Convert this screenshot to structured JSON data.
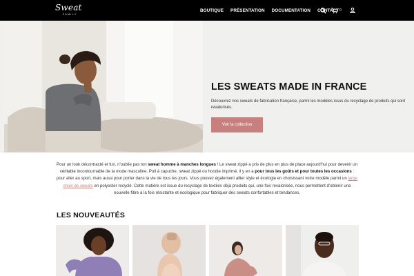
{
  "brand": {
    "name": "Sweat",
    "sub": "FAMILY"
  },
  "nav": {
    "items": [
      "BOUTIQUE",
      "PRÉSENTATION",
      "DOCUMENTATION",
      "CONTACT"
    ],
    "cart_count": "0"
  },
  "icons": [
    "search-icon",
    "cart-icon",
    "user-icon"
  ],
  "hero": {
    "title": "LES SWEATS MADE IN FRANCE",
    "text": "Découvrez nos sweats de fabrication française, parmi les modèles issus du recyclage de produits qui sont revalorisés.",
    "button": "Voir la collection"
  },
  "intro": {
    "p1": "Pour un look décontracté et fun, n'oublie pas ton ",
    "b1": "sweat homme à manches longues",
    "p2": " ! Le sweat zippé a pris de plus en plus de place aujourd'hui pour devenir un véritable incontournable de la mode masculine. Pull à capuche, sweat zippé ou hoodie imprimé, il y en a ",
    "b2": "pour tous les goûts et pour toutes les occasions",
    "p3": " : pour aller au sport, mais aussi pour porter dans la vie de tous les jours. Vous pouvez également allier style et écologie en choisissant votre modèle parmi un ",
    "link": "large choix de sweats",
    "p4": " en polyester recyclé. Cette matière est issue du recyclage de textiles déjà produits qui, une fois revalorisée, nous permettent d'obtenir une nouvelle fibre à la fois résistante et écologique pour fabriquer des sweats confortables et tendances."
  },
  "new_section": {
    "title": "LES NOUVEAUTÉS"
  },
  "colors": {
    "accent": "#c8807f",
    "header": "#000000",
    "hero_bg": "#f0f0ee"
  }
}
